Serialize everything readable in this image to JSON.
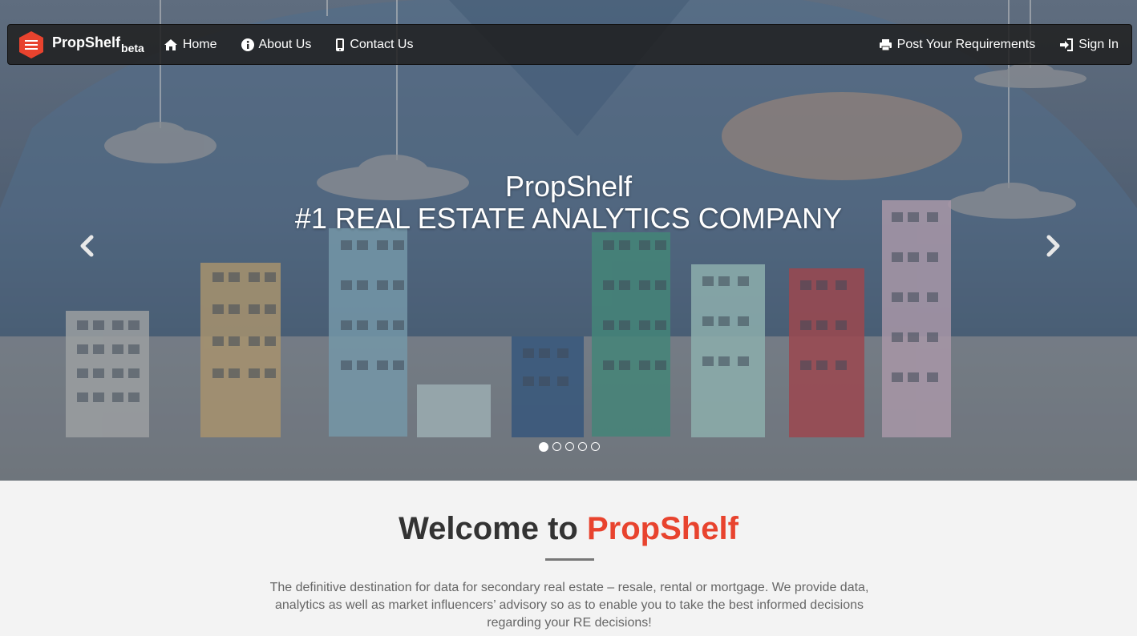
{
  "brand": {
    "name": "PropShelf",
    "suffix": "beta"
  },
  "nav": {
    "left": [
      {
        "label": "Home",
        "icon": "home-icon"
      },
      {
        "label": "About Us",
        "icon": "info-icon"
      },
      {
        "label": "Contact Us",
        "icon": "mobile-icon"
      }
    ],
    "right": [
      {
        "label": "Post Your Requirements",
        "icon": "print-icon"
      },
      {
        "label": "Sign In",
        "icon": "sign-in-icon"
      }
    ]
  },
  "hero": {
    "title": "PropShelf",
    "subtitle": "#1 REAL ESTATE ANALYTICS COMPANY",
    "slide_count": 5,
    "active_slide": 1
  },
  "welcome": {
    "title_prefix": "Welcome to",
    "title_accent": "PropShelf",
    "text": "The definitive destination for data for secondary real estate – resale, rental or mortgage. We provide data, analytics as well as market influencers’ advisory so as to enable you to take the best informed decisions regarding your RE decisions!"
  },
  "colors": {
    "accent": "#e8432e",
    "navbar": "#1e1e1e"
  }
}
